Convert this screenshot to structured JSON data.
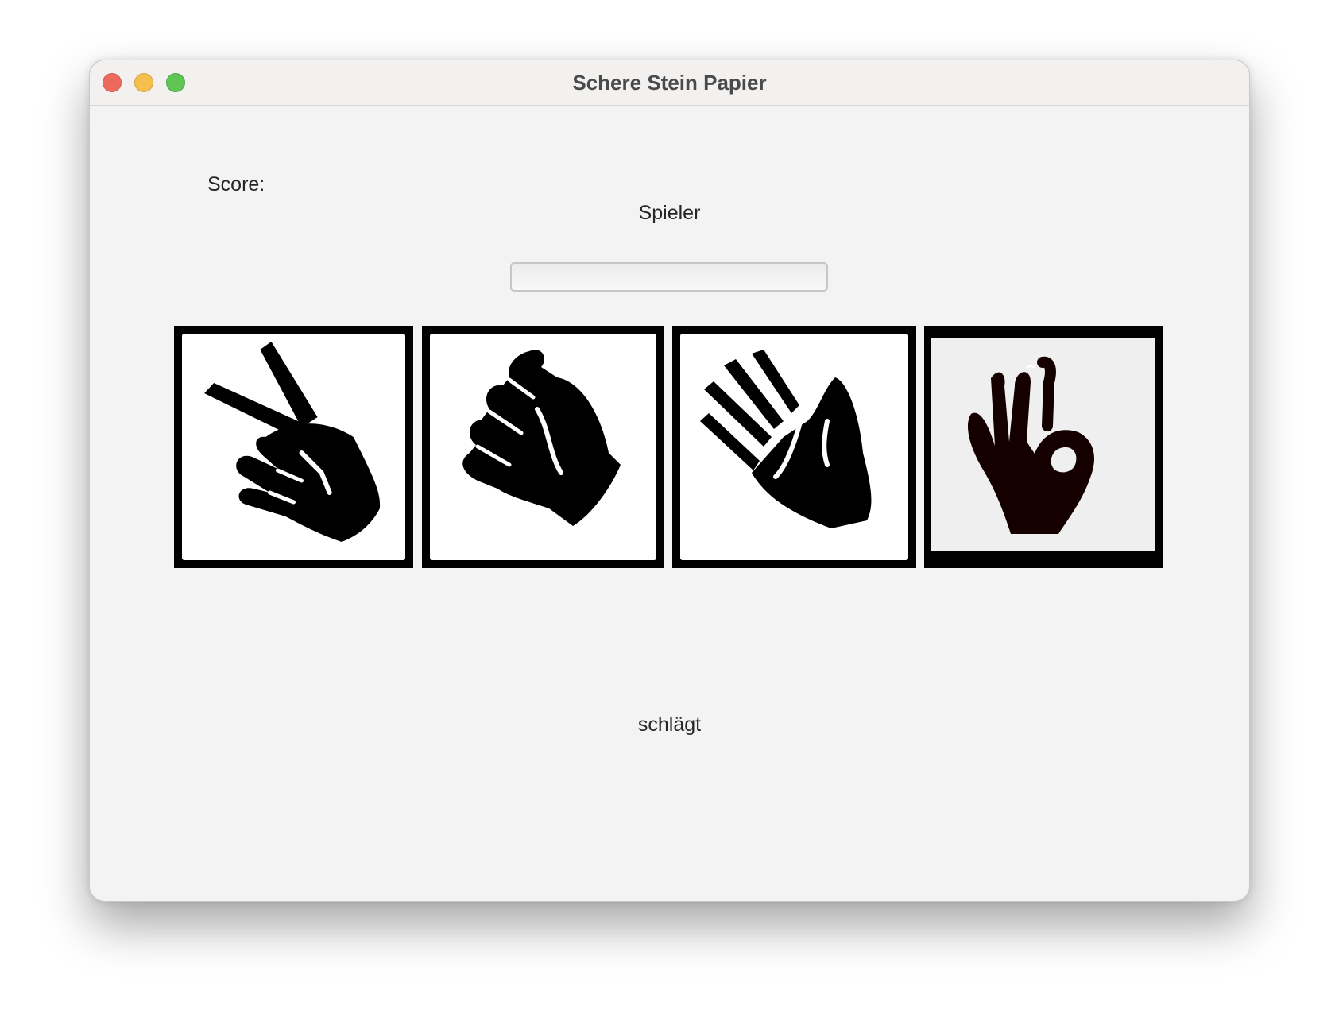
{
  "window": {
    "title": "Schere Stein Papier"
  },
  "score": {
    "label": "Score:"
  },
  "player": {
    "label": "Spieler",
    "input_value": ""
  },
  "choices": [
    {
      "icon": "scissors-hand-icon"
    },
    {
      "icon": "rock-fist-icon"
    },
    {
      "icon": "paper-hand-icon"
    },
    {
      "icon": "ok-hand-icon"
    }
  ],
  "result": {
    "label": "schlägt"
  },
  "colors": {
    "close": "#ec6a5e",
    "minimize": "#f4bf4f",
    "maximize": "#61c554",
    "window_bg": "#f3f3f3"
  }
}
